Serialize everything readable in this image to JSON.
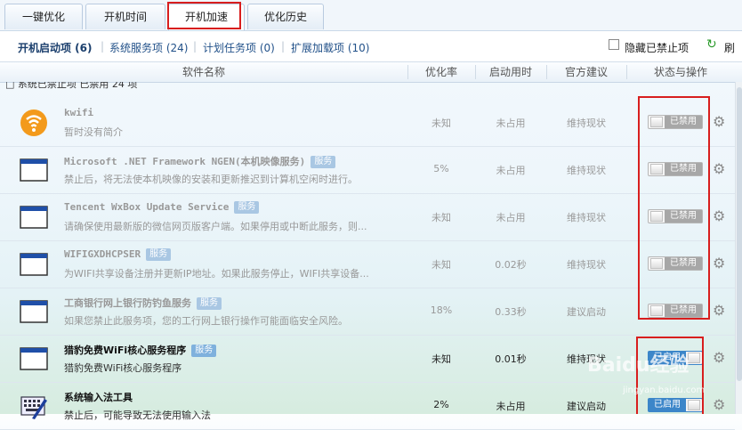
{
  "tabs": [
    {
      "label": "一键优化"
    },
    {
      "label": "开机时间"
    },
    {
      "label": "开机加速"
    },
    {
      "label": "优化历史"
    }
  ],
  "subtabs": [
    {
      "label": "开机启动项 (6)"
    },
    {
      "label": "系统服务项 (24)"
    },
    {
      "label": "计划任务项 (0)"
    },
    {
      "label": "扩展加载项 (10)"
    }
  ],
  "hide_disabled_label": "隐藏已禁止项",
  "refresh_label": "刷",
  "columns": {
    "name": "软件名称",
    "rate": "优化率",
    "time": "启动用时",
    "advice": "官方建议",
    "status": "状态与操作"
  },
  "group_label": "□ 系统已禁止项  已禁用 24 项",
  "rows": [
    {
      "name": "kwifi",
      "badge": "",
      "desc": "暂时没有简介",
      "rate": "未知",
      "time": "未占用",
      "advice": "维持现状",
      "status": "已禁用",
      "icon": "wifi-icon",
      "state": "disabled"
    },
    {
      "name": "Microsoft .NET Framework NGEN(本机映像服务)",
      "badge": "服务",
      "desc": "禁止后，将无法使本机映像的安装和更新推迟到计算机空闲时进行。",
      "rate": "5%",
      "time": "未占用",
      "advice": "维持现状",
      "status": "已禁用",
      "icon": "window-icon",
      "state": "disabled"
    },
    {
      "name": "Tencent WxBox Update Service",
      "badge": "服务",
      "desc": "请确保使用最新版的微信网页版客户端。如果停用或中断此服务，则...",
      "rate": "未知",
      "time": "未占用",
      "advice": "维持现状",
      "status": "已禁用",
      "icon": "window-icon",
      "state": "disabled"
    },
    {
      "name": "WIFIGXDHCPSER",
      "badge": "服务",
      "desc": "为WIFI共享设备注册并更新IP地址。如果此服务停止，WIFI共享设备...",
      "rate": "未知",
      "time": "0.02秒",
      "advice": "维持现状",
      "status": "已禁用",
      "icon": "window-icon",
      "state": "disabled"
    },
    {
      "name": "工商银行网上银行防钓鱼服务",
      "badge": "服务",
      "desc": "如果您禁止此服务项，您的工行网上银行操作可能面临安全风险。",
      "rate": "18%",
      "time": "0.33秒",
      "advice": "建议启动",
      "status": "已禁用",
      "icon": "window-icon",
      "state": "disabled"
    },
    {
      "name": "猎豹免费WiFi核心服务程序",
      "badge": "服务",
      "desc": "猎豹免费WiFi核心服务程序",
      "rate": "未知",
      "time": "0.01秒",
      "advice": "维持现状",
      "status": "已启用",
      "icon": "window-icon",
      "state": "enabled"
    },
    {
      "name": "系统输入法工具",
      "badge": "",
      "desc": "禁止后，可能导致无法使用输入法",
      "rate": "2%",
      "time": "未占用",
      "advice": "建议启动",
      "status": "已启用",
      "icon": "keyboard-pen-icon",
      "state": "enabled"
    }
  ],
  "watermark": "Baidu经验",
  "watermark_url": "jingyan.baidu.com",
  "colors": {
    "accent": "#3c86c9",
    "highlight": "#d81e1e",
    "disabled_toggle": "#a7a7a7"
  }
}
